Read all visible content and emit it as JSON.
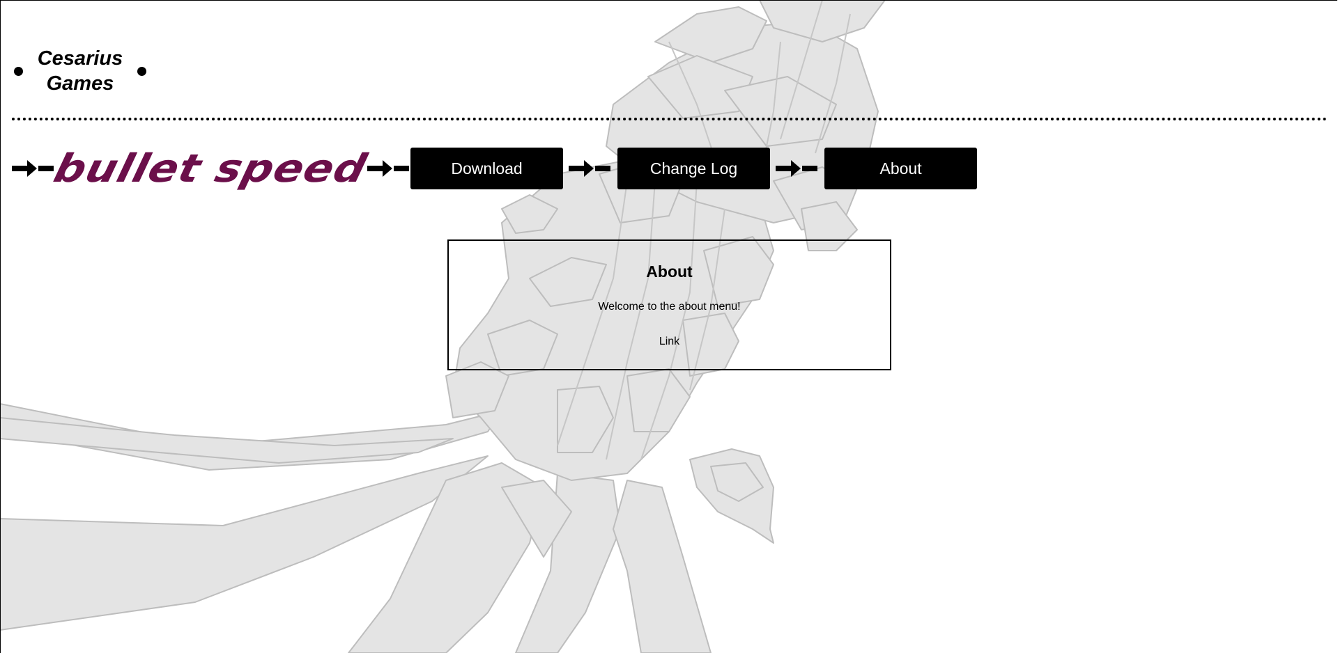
{
  "brand": {
    "line1": "Cesarius",
    "line2": "Games"
  },
  "nav": {
    "logo_text": "bullet speed",
    "buttons": [
      "Download",
      "Change Log",
      "About"
    ]
  },
  "panel": {
    "title": "About",
    "text": "Welcome to the about menu!",
    "link_label": "Link"
  },
  "colors": {
    "logo": "#6b0f4a",
    "button_bg": "#000000",
    "button_text": "#ffffff",
    "art_fill": "#e3e3e3",
    "art_stroke": "#bdbdbd"
  }
}
